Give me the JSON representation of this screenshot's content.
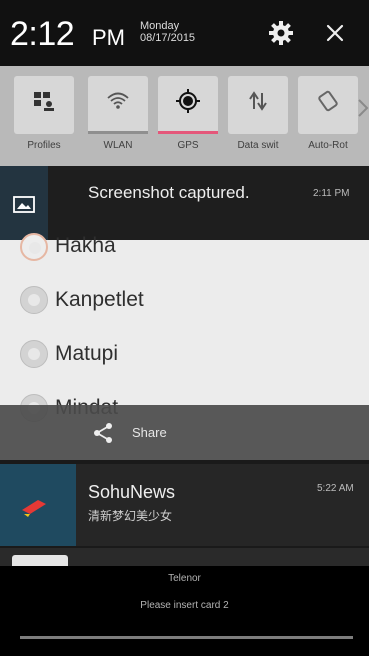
{
  "status_header": {
    "time": "2:12",
    "ampm": "PM",
    "day": "Monday",
    "date": "08/17/2015",
    "settings_icon": "gear-icon",
    "close_icon": "close-icon"
  },
  "quick_settings": {
    "tiles": [
      {
        "label": "Profiles",
        "icon": "profiles-icon",
        "active": false
      },
      {
        "label": "WLAN",
        "icon": "wifi-icon",
        "active": false
      },
      {
        "label": "GPS",
        "icon": "gps-icon",
        "active": true
      },
      {
        "label": "Data swit",
        "icon": "data-switch-icon",
        "active": false
      },
      {
        "label": "Auto-Rot",
        "icon": "auto-rotate-icon",
        "active": false
      }
    ],
    "more_icon": "chevron-right-icon",
    "active_color": "#e4577a"
  },
  "notification_screenshot": {
    "icon": "image-icon",
    "title": "Screenshot captured.",
    "time": "2:11 PM"
  },
  "app_list": {
    "options": [
      "Hakha",
      "Kanpetlet",
      "Matupi",
      "Mindat"
    ],
    "selected": "Hakha"
  },
  "share_action": {
    "icon": "share-icon",
    "label": "Share"
  },
  "notification_sohu": {
    "app": "SohuNews",
    "message": "清新梦幻美少女",
    "time": "5:22 AM",
    "icon": "sohu-logo-icon"
  },
  "footer": {
    "carrier": "Telenor",
    "sim_status": "Please insert card 2"
  }
}
